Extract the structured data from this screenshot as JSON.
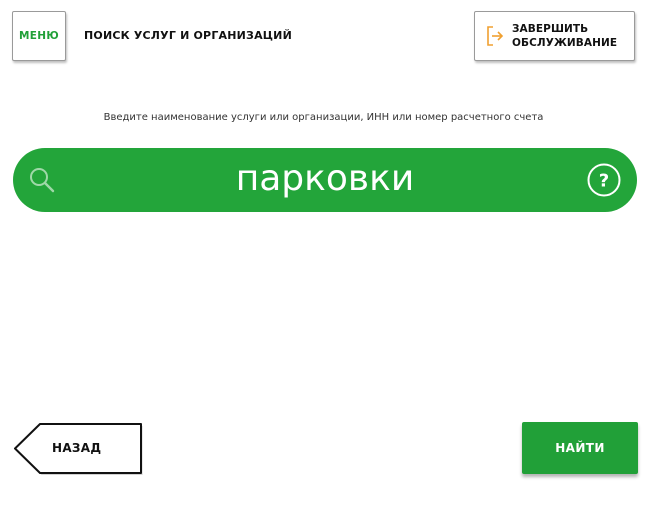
{
  "header": {
    "menu_label": "МЕНЮ",
    "title": "ПОИСК УСЛУГ И ОРГАНИЗАЦИЙ",
    "end_service_label": "ЗАВЕРШИТЬ\nОБСЛУЖИВАНИЕ"
  },
  "search": {
    "hint": "Введите наименование услуги или организации, ИНН или номер расчетного счета",
    "query": "парковки"
  },
  "footer": {
    "back_label": "НАЗАД",
    "find_label": "НАЙТИ"
  },
  "colors": {
    "accent_green": "#21a038",
    "search_green": "#23a53a",
    "exit_icon_orange": "#f0a030"
  },
  "icons": {
    "search": "search-icon",
    "help": "help-icon",
    "exit": "exit-icon",
    "back": "back-arrow-shape"
  }
}
